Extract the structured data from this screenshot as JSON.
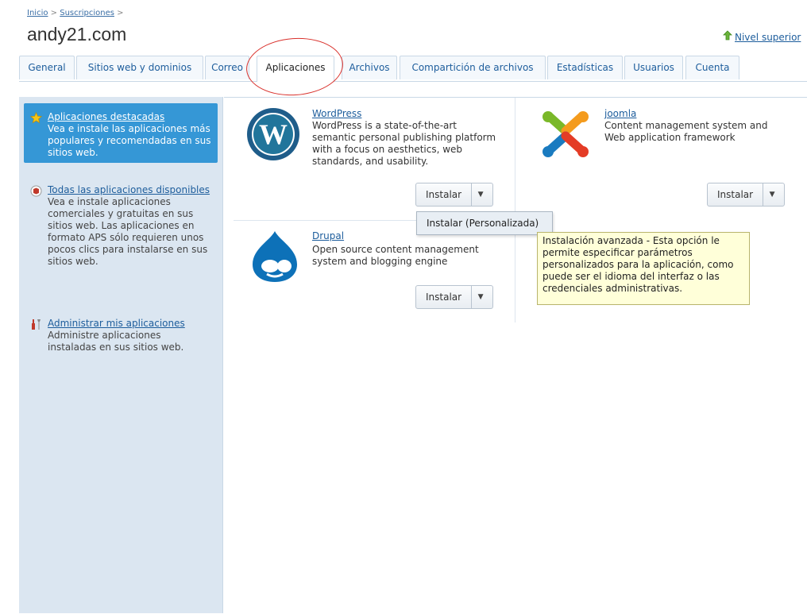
{
  "breadcrumb": {
    "home": "Inicio",
    "sep1": ">",
    "subscriptions": "Suscripciones",
    "sep2": ">"
  },
  "page_title": "andy21.com",
  "level_up": {
    "label": "Nivel superior"
  },
  "tabs": [
    {
      "label": "General"
    },
    {
      "label": "Sitios web y dominios"
    },
    {
      "label": "Correo"
    },
    {
      "label": "Aplicaciones"
    },
    {
      "label": "Archivos"
    },
    {
      "label": "Compartición de archivos"
    },
    {
      "label": "Estadísticas"
    },
    {
      "label": "Usuarios"
    },
    {
      "label": "Cuenta"
    }
  ],
  "sidebar": {
    "items": [
      {
        "title": "Aplicaciones destacadas",
        "desc": "Vea e instale las aplicaciones más populares y recomendadas en sus sitios web."
      },
      {
        "title": "Todas las aplicaciones disponibles",
        "desc": "Vea e instale aplicaciones comerciales y gratuitas en sus sitios web. Las aplicaciones en formato APS sólo requieren unos pocos clics para instalarse en sus sitios web."
      },
      {
        "title": "Administrar mis aplicaciones",
        "desc": "Administre aplicaciones instaladas en sus sitios web."
      }
    ]
  },
  "apps": [
    {
      "name": "WordPress",
      "desc": "WordPress is a state-of-the-art semantic personal publishing platform with a focus on aesthetics, web standards, and usability.",
      "install": "Instalar"
    },
    {
      "name": "joomla",
      "desc": "Content management system and Web application framework",
      "install": "Instalar"
    },
    {
      "name": "Drupal",
      "desc": "Open source content management system and blogging engine",
      "install": "Instalar"
    }
  ],
  "dropdown": {
    "item": "Instalar (Personalizada)"
  },
  "tooltip": {
    "text": "Instalación avanzada - Esta opción le permite especificar parámetros personalizados para la aplicación, como puede ser el idioma del interfaz o las credenciales administrativas."
  },
  "colors": {
    "accent": "#3597d6",
    "link": "#1d5d9c",
    "sidebar_bg": "#dbe6f1",
    "annotation": "#d9302b",
    "tooltip_bg": "#ffffd9"
  },
  "icons": {
    "level_up": "green-up-arrow-icon",
    "featured": "star-icon",
    "all_apps": "aps-cube-icon",
    "manage": "tools-icon"
  }
}
